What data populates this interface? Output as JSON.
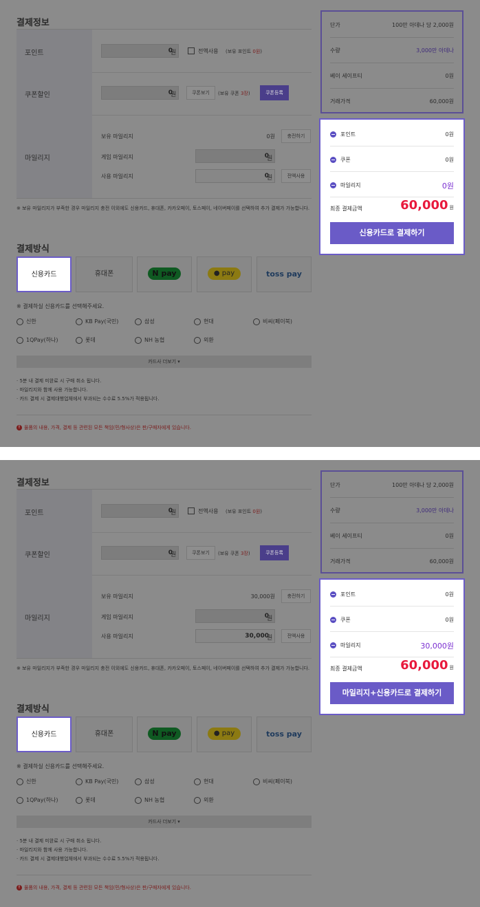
{
  "panels": [
    {
      "payment_info_title": "결제정보",
      "point_label": "포인트",
      "point_value": "0",
      "point_unit": "원",
      "use_all_label": "전액사용",
      "owned_point_prefix": "(보유 포인트 ",
      "owned_point_value": "0원",
      "owned_point_suffix": ")",
      "coupon_label": "쿠폰할인",
      "coupon_value": "0",
      "coupon_unit": "원",
      "coupon_view_button": "쿠폰보기",
      "owned_coupon_prefix": "(보유 쿠폰 ",
      "owned_coupon_value": "3장",
      "owned_coupon_suffix": ")",
      "coupon_register_button": "쿠폰등록",
      "mileage_label": "마일리지",
      "owned_mileage_label": "보유 마일리지",
      "owned_mileage_value": "0원",
      "charge_button": "충전하기",
      "game_mileage_label": "게임 마일리지",
      "game_mileage_value": "0",
      "game_mileage_unit": "원",
      "use_mileage_label": "사용 마일리지",
      "use_mileage_value": "0",
      "use_mileage_unit": "원",
      "use_all_button": "전액사용",
      "mileage_note": "※ 보유 마일리지가 부족한 경우 마일리지 충전 이외에도 신용카드, 휴대폰, 카카오페이, 토스페이, 네이버페이를 선택하여 추가 결제가 가능합니다.",
      "method_title": "결제방식",
      "methods": [
        "신용카드",
        "휴대폰",
        "pay",
        "pay",
        "toss pay"
      ],
      "npay_n": "N",
      "card_select_note": "※ 결제하실 신용카드를 선택해주세요.",
      "cards_row1": [
        "신한",
        "KB Pay(국민)",
        "삼성",
        "현대",
        "비씨(페이북)"
      ],
      "cards_row2": [
        "1QPay(하나)",
        "롯데",
        "NH 농협",
        "외환"
      ],
      "more_cards": "카드사 더보기  ▾",
      "bullet1": "· 5분 내 결제 미완료 시 구매 취소 됩니다.",
      "bullet2": "· 마일리지와 함께 사용 가능합니다.",
      "bullet3": "· 카드 결제 시 결제대행업체에서 부과되는 수수료 5.5%가 적용됩니다.",
      "warning": "물품의 내용, 가격, 결제 등 관련된 모든 책임(민/형사상)은 판/구매자에게 있습니다.",
      "unit_price_label": "단가",
      "unit_price_value": "100만 아데나 당 2,000원",
      "quantity_label": "수량",
      "quantity_value": "3,000만 아데나",
      "safety_label": "베이 세이프티",
      "safety_value": "0원",
      "trade_price_label": "거래가격",
      "trade_price_value": "60,000원",
      "d_point_label": "포인트",
      "d_point_value": "0원",
      "d_coupon_label": "쿠폰",
      "d_coupon_value": "0원",
      "d_mileage_label": "마일리지",
      "d_mileage_value": "0원",
      "final_label": "최종 결제금액",
      "final_value": "60,000",
      "final_unit": "원",
      "pay_button": "신용카드로 결제하기"
    },
    {
      "payment_info_title": "결제정보",
      "point_label": "포인트",
      "point_value": "0",
      "point_unit": "원",
      "use_all_label": "전액사용",
      "owned_point_prefix": "(보유 포인트 ",
      "owned_point_value": "0원",
      "owned_point_suffix": ")",
      "coupon_label": "쿠폰할인",
      "coupon_value": "0",
      "coupon_unit": "원",
      "coupon_view_button": "쿠폰보기",
      "owned_coupon_prefix": "(보유 쿠폰 ",
      "owned_coupon_value": "3장",
      "owned_coupon_suffix": ")",
      "coupon_register_button": "쿠폰등록",
      "mileage_label": "마일리지",
      "owned_mileage_label": "보유 마일리지",
      "owned_mileage_value": "30,000원",
      "charge_button": "충전하기",
      "game_mileage_label": "게임 마일리지",
      "game_mileage_value": "0",
      "game_mileage_unit": "원",
      "use_mileage_label": "사용 마일리지",
      "use_mileage_value": "30,000",
      "use_mileage_unit": "원",
      "use_all_button": "전액사용",
      "mileage_note": "※ 보유 마일리지가 부족한 경우 마일리지 충전 이외에도 신용카드, 휴대폰, 카카오페이, 토스페이, 네이버페이를 선택하여 추가 결제가 가능합니다.",
      "method_title": "결제방식",
      "methods": [
        "신용카드",
        "휴대폰",
        "pay",
        "pay",
        "toss pay"
      ],
      "npay_n": "N",
      "card_select_note": "※ 결제하실 신용카드를 선택해주세요.",
      "cards_row1": [
        "신한",
        "KB Pay(국민)",
        "삼성",
        "현대",
        "비씨(페이북)"
      ],
      "cards_row2": [
        "1QPay(하나)",
        "롯데",
        "NH 농협",
        "외환"
      ],
      "more_cards": "카드사 더보기  ▾",
      "bullet1": "· 5분 내 결제 미완료 시 구매 취소 됩니다.",
      "bullet2": "· 마일리지와 함께 사용 가능합니다.",
      "bullet3": "· 카드 결제 시 결제대행업체에서 부과되는 수수료 5.5%가 적용됩니다.",
      "warning": "물품의 내용, 가격, 결제 등 관련된 모든 책임(민/형사상)은 판/구매자에게 있습니다.",
      "unit_price_label": "단가",
      "unit_price_value": "100만 아데나 당 2,000원",
      "quantity_label": "수량",
      "quantity_value": "3,000만 아데나",
      "safety_label": "베이 세이프티",
      "safety_value": "0원",
      "trade_price_label": "거래가격",
      "trade_price_value": "60,000원",
      "d_point_label": "포인트",
      "d_point_value": "0원",
      "d_coupon_label": "쿠폰",
      "d_coupon_value": "0원",
      "d_mileage_label": "마일리지",
      "d_mileage_value": "30,000원",
      "final_label": "최종 결제금액",
      "final_value": "60,000",
      "final_unit": "원",
      "pay_button": "마일리지+신용카드로 결제하기"
    }
  ],
  "colors": {
    "accent": "#6a5bc7",
    "total_red": "#e8193c",
    "mileage_purple": "#7a2ed1",
    "overlay_grey": "#8b8b8b"
  }
}
